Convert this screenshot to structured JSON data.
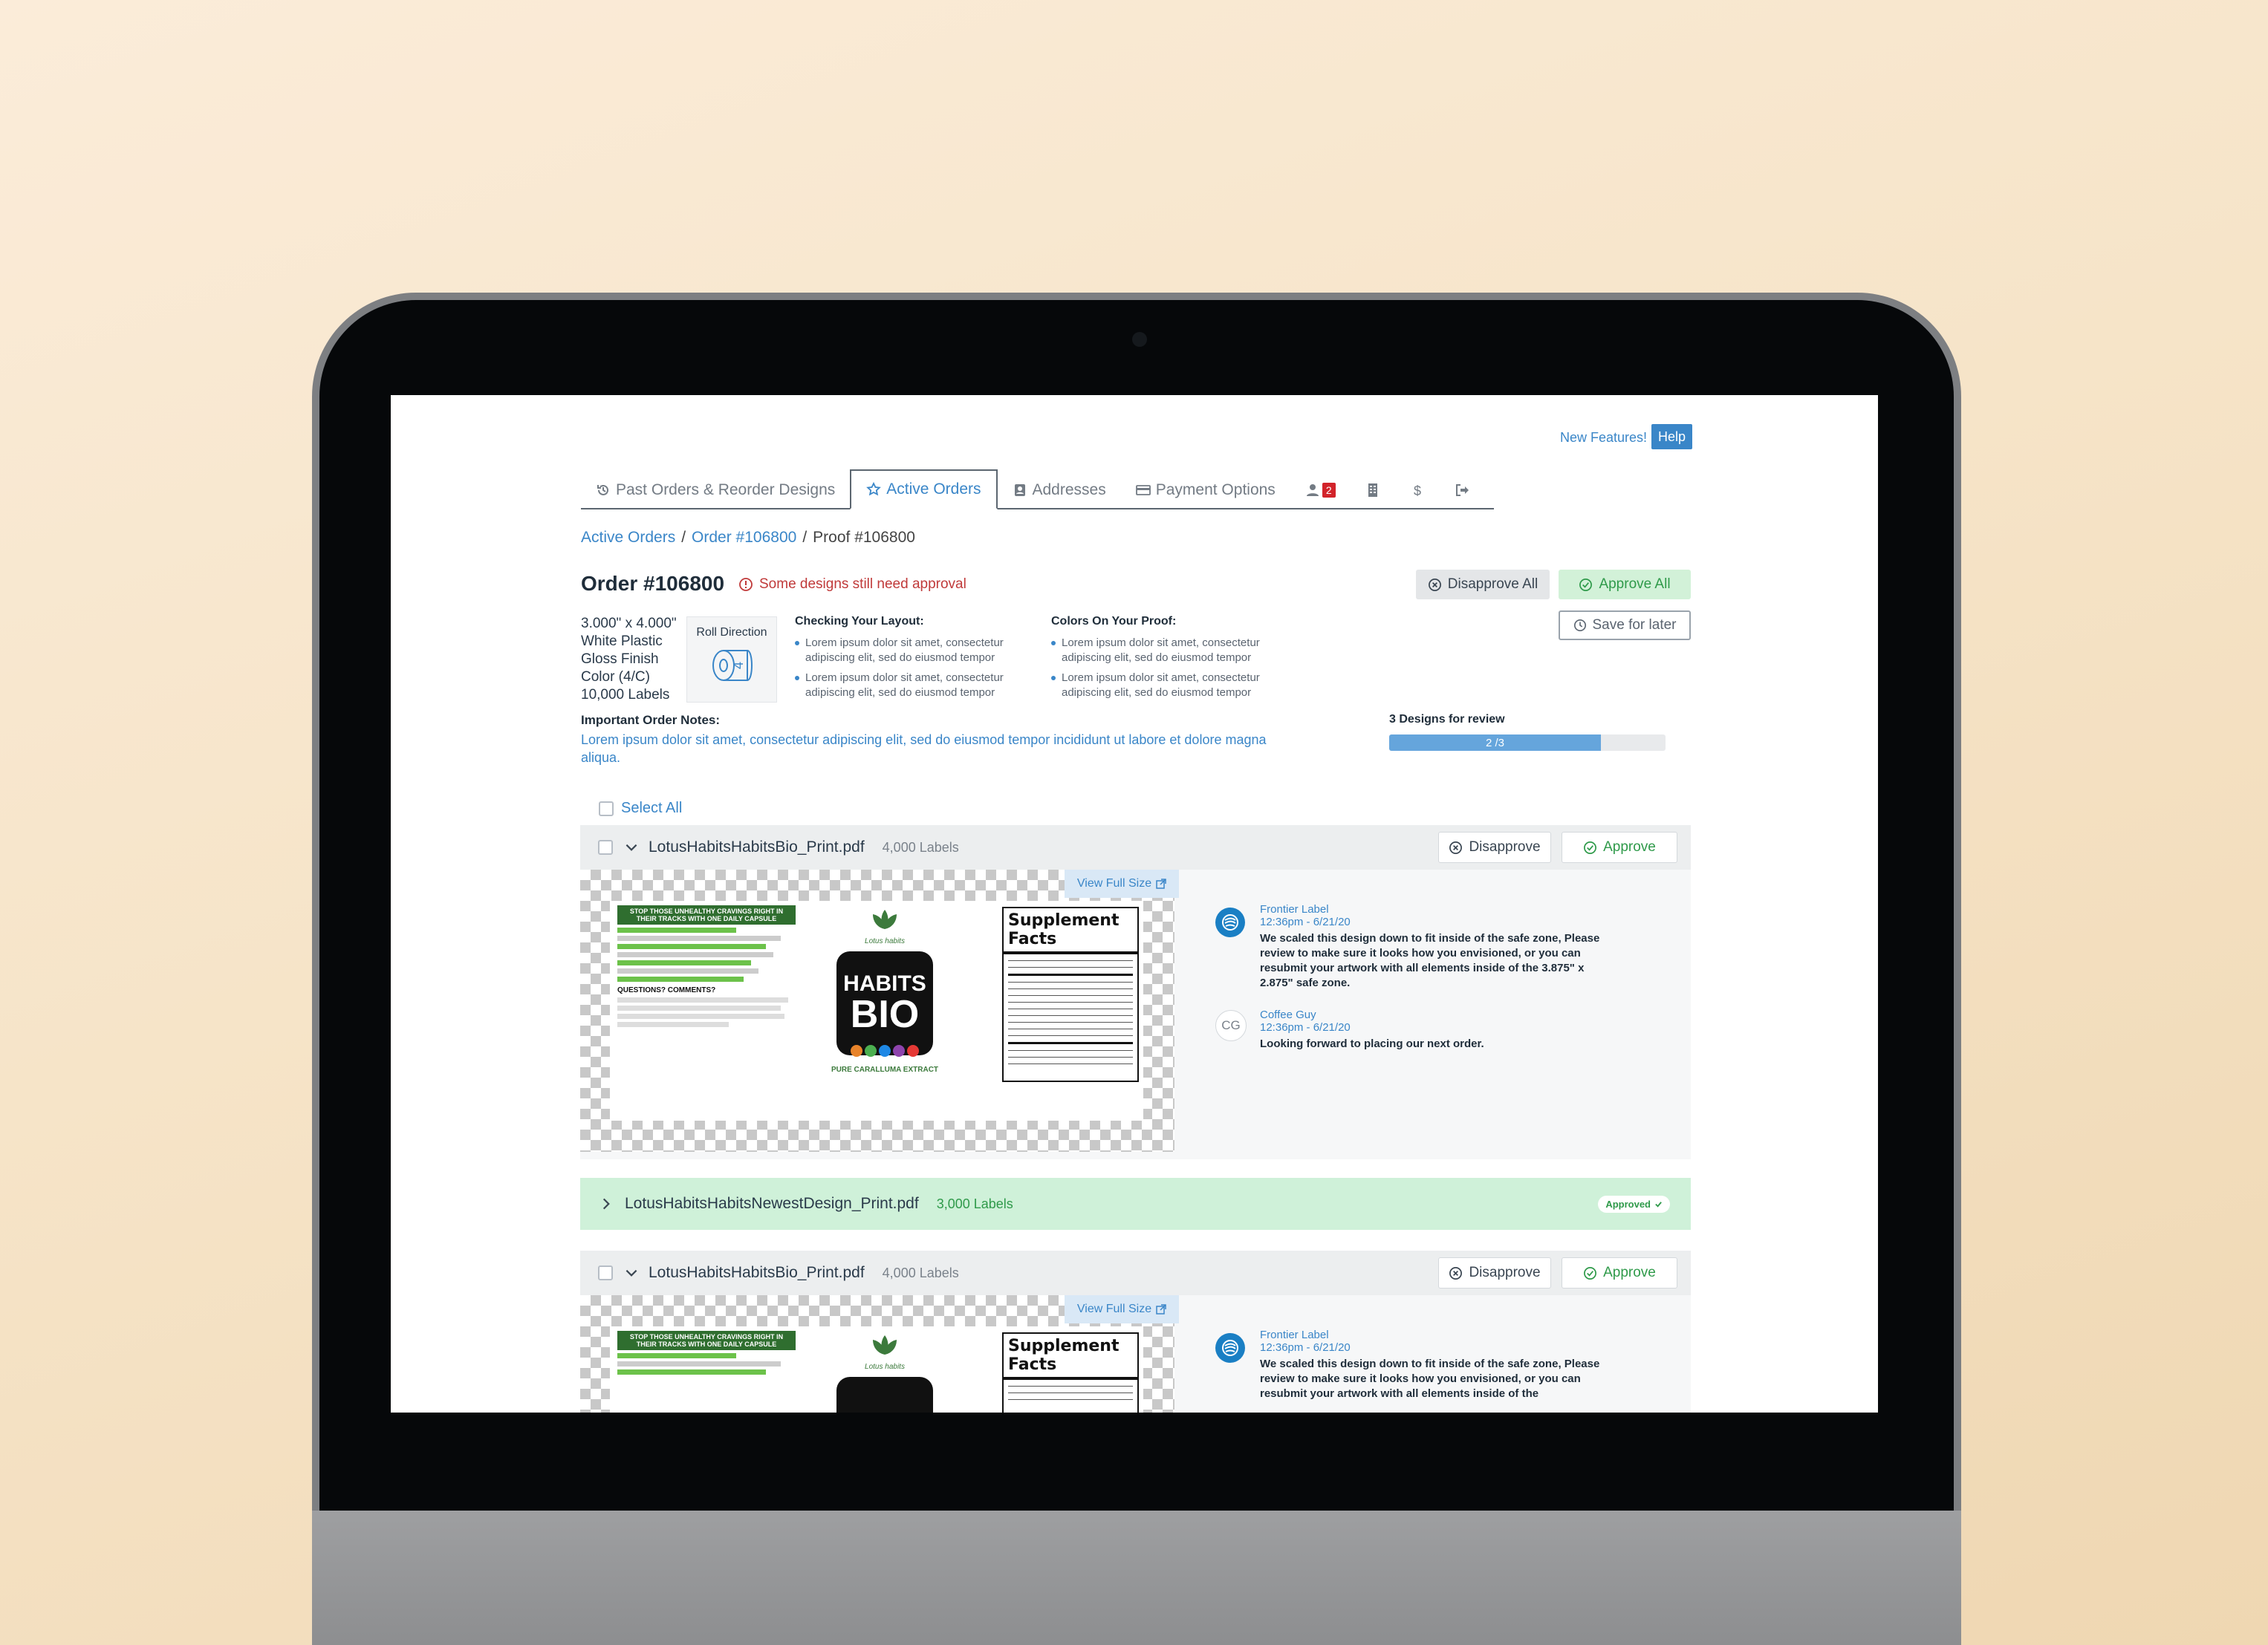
{
  "topbar": {
    "new_features": "New Features!",
    "help": "Help"
  },
  "tabs": [
    {
      "label": "Past Orders & Reorder Designs",
      "icon": "history-icon"
    },
    {
      "label": "Active Orders",
      "icon": "star-icon"
    },
    {
      "label": "Addresses",
      "icon": "address-book-icon"
    },
    {
      "label": "Payment Options",
      "icon": "credit-card-icon"
    },
    {
      "label": "",
      "icon": "users-icon",
      "badge": "2"
    },
    {
      "label": "",
      "icon": "building-icon"
    },
    {
      "label": "",
      "icon": "dollar-icon"
    },
    {
      "label": "",
      "icon": "sign-out-icon"
    }
  ],
  "breadcrumb": {
    "active_orders": "Active Orders",
    "order": "Order #106800",
    "proof": "Proof #106800",
    "sep": "/"
  },
  "order": {
    "title": "Order #106800",
    "alert": "Some designs still need approval",
    "disapprove_all": "Disapprove All",
    "approve_all": "Approve All",
    "save_later": "Save for later",
    "specs": [
      "3.000\" x 4.000\"",
      "White Plastic",
      "Gloss Finish",
      "Color (4/C)",
      "10,000 Labels"
    ],
    "roll_direction": "Roll Direction",
    "roll_number": "4"
  },
  "layout_hints": {
    "title": "Checking Your Layout:",
    "items": [
      "Lorem ipsum dolor sit amet, consectetur adipiscing elit, sed do eiusmod tempor",
      "Lorem ipsum dolor sit amet, consectetur adipiscing elit, sed do eiusmod tempor"
    ]
  },
  "color_hints": {
    "title": "Colors On Your Proof:",
    "items": [
      "Lorem ipsum dolor sit amet, consectetur adipiscing elit, sed do eiusmod tempor",
      "Lorem ipsum dolor sit amet, consectetur adipiscing elit, sed do eiusmod tempor"
    ]
  },
  "notes": {
    "title": "Important Order Notes:",
    "text": "Lorem ipsum dolor sit amet, consectetur adipiscing elit, sed do eiusmod tempor incididunt ut labore et dolore magna aliqua."
  },
  "review": {
    "title": "3 Designs for review",
    "progress_text": "2 /3",
    "progress_value": 0.766
  },
  "select_all": "Select All",
  "files": [
    {
      "name": "LotusHabitsHabitsBio_Print.pdf",
      "count": "4,000 Labels",
      "disapprove": "Disapprove",
      "approve": "Approve",
      "view_full": "View Full Size",
      "comments": [
        {
          "author": "Frontier Label",
          "time": "12:36pm - 6/21/20",
          "text": "We scaled this design down to fit inside of the safe zone, Please review to make sure it looks how you envisioned, or you can resubmit your artwork with all elements inside of the 3.875\" x 2.875\" safe zone."
        },
        {
          "author": "Coffee Guy",
          "initials": "CG",
          "time": "12:36pm - 6/21/20",
          "text": "Looking forward to placing our next order."
        }
      ]
    },
    {
      "name": "LotusHabitsHabitsNewestDesign_Print.pdf",
      "count": "3,000 Labels",
      "status": "Approved"
    },
    {
      "name": "LotusHabitsHabitsBio_Print.pdf",
      "count": "4,000 Labels",
      "disapprove": "Disapprove",
      "approve": "Approve",
      "view_full": "View Full Size",
      "comments": [
        {
          "author": "Frontier Label",
          "time": "12:36pm - 6/21/20",
          "text": "We scaled this design down to fit inside of the safe zone, Please review to make sure it looks how you envisioned, or you can resubmit your artwork with all elements inside of the"
        }
      ]
    }
  ],
  "label_art": {
    "headline": "STOP THOSE UNHEALTHY CRAVINGS RIGHT IN THEIR TRACKS WITH ONE DAILY CAPSULE",
    "brand_top": "HABITS",
    "brand_bottom": "BIO",
    "tagline": "PURE CARALLUMA EXTRACT",
    "questions": "QUESTIONS? COMMENTS?",
    "facts_title": "Supplement Facts",
    "logo_script": "Lotus habits"
  },
  "colors": {
    "accent": "#3a86c8",
    "approve": "#2f9a4a",
    "alert": "#c03a3a",
    "approved_bg": "#cff1d9"
  }
}
